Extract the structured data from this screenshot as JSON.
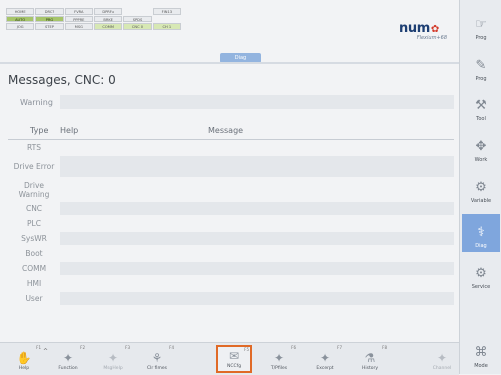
{
  "status_strip": [
    {
      "text": "HOME",
      "state": ""
    },
    {
      "text": "DRC?",
      "state": ""
    },
    {
      "text": "FVRA",
      "state": ""
    },
    {
      "text": "DPRFu",
      "state": ""
    },
    {
      "text": "",
      "state": "blank"
    },
    {
      "text": "FIN13",
      "state": ""
    },
    {
      "text": "AUTO",
      "state": "on"
    },
    {
      "text": "PRG",
      "state": "on"
    },
    {
      "text": "PPPRE",
      "state": ""
    },
    {
      "text": "BRKE",
      "state": ""
    },
    {
      "text": "SPDS",
      "state": ""
    },
    {
      "text": "",
      "state": "blank"
    },
    {
      "text": "JOG",
      "state": ""
    },
    {
      "text": "STEP",
      "state": ""
    },
    {
      "text": "MSG",
      "state": ""
    },
    {
      "text": "COMM",
      "state": "hi"
    },
    {
      "text": "CNC 0",
      "state": "hi"
    },
    {
      "text": "CH 1",
      "state": "hi"
    }
  ],
  "logo": {
    "name": "num",
    "tagline": "Flexium+68"
  },
  "active_tab": "Diag",
  "title": "Messages, CNC: 0",
  "warning_label": "Warning",
  "table": {
    "headers": {
      "type": "Type",
      "help": "Help",
      "message": "Message"
    },
    "rows": [
      {
        "type": "RTS",
        "shade": false,
        "tall": false
      },
      {
        "type": "Drive Error",
        "shade": true,
        "tall": true
      },
      {
        "type": "Drive Warning",
        "shade": false,
        "tall": true
      },
      {
        "type": "CNC",
        "shade": true,
        "tall": false
      },
      {
        "type": "PLC",
        "shade": false,
        "tall": false
      },
      {
        "type": "SysWR",
        "shade": true,
        "tall": false
      },
      {
        "type": "Boot",
        "shade": false,
        "tall": false
      },
      {
        "type": "COMM",
        "shade": true,
        "tall": false
      },
      {
        "type": "HMI",
        "shade": false,
        "tall": false
      },
      {
        "type": "User",
        "shade": true,
        "tall": false
      }
    ]
  },
  "side_buttons": [
    {
      "label": "Prog",
      "fkey": "",
      "icon": "☞",
      "active": false
    },
    {
      "label": "Prog",
      "fkey": "",
      "icon": "✎",
      "active": false
    },
    {
      "label": "Tool",
      "fkey": "",
      "icon": "⚒",
      "active": false
    },
    {
      "label": "Work",
      "fkey": "",
      "icon": "✥",
      "active": false
    },
    {
      "label": "Variable",
      "fkey": "",
      "icon": "⚙",
      "active": false
    },
    {
      "label": "Diag",
      "fkey": "",
      "icon": "⚕",
      "active": true
    },
    {
      "label": "Service",
      "fkey": "",
      "icon": "⚙",
      "active": false
    },
    {
      "label": "",
      "fkey": "",
      "icon": "",
      "active": false
    },
    {
      "label": "",
      "fkey": "",
      "icon": "",
      "active": false
    },
    {
      "label": "Mode",
      "fkey": "",
      "icon": "⌘",
      "active": false
    }
  ],
  "bottom_buttons": [
    {
      "label": "Help",
      "fkey": "F1",
      "icon": "✋",
      "state": ""
    },
    {
      "label": "Function",
      "fkey": "F2",
      "icon": "✦",
      "state": ""
    },
    {
      "label": "MsgHelp",
      "fkey": "F3",
      "icon": "✦",
      "state": "dim"
    },
    {
      "label": "Clr fimes",
      "fkey": "F4",
      "icon": "⚘",
      "state": ""
    },
    {
      "label": "NCCfg",
      "fkey": "F5",
      "icon": "✉",
      "state": "selected"
    },
    {
      "label": "T/Pfiles",
      "fkey": "F6",
      "icon": "✦",
      "state": ""
    },
    {
      "label": "Excerpt",
      "fkey": "F7",
      "icon": "✦",
      "state": ""
    },
    {
      "label": "History",
      "fkey": "F8",
      "icon": "⚗",
      "state": ""
    },
    {
      "label": "Channel",
      "fkey": "",
      "icon": "✦",
      "state": "dim"
    }
  ]
}
